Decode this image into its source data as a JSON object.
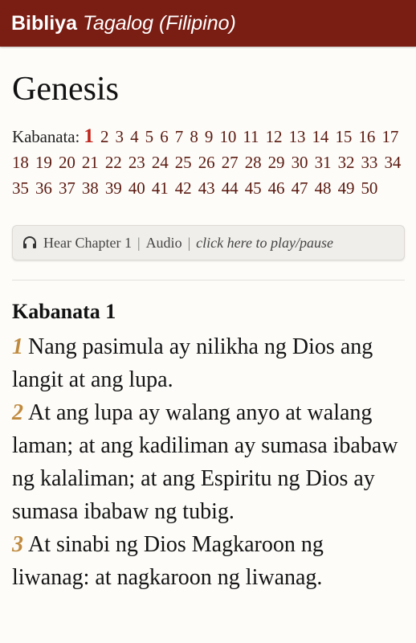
{
  "header": {
    "brand": "Bibliya",
    "language": "Tagalog (Filipino)"
  },
  "book": {
    "title": "Genesis"
  },
  "chapters": {
    "label": "Kabanata:",
    "current": "1",
    "list": [
      "1",
      "2",
      "3",
      "4",
      "5",
      "6",
      "7",
      "8",
      "9",
      "10",
      "11",
      "12",
      "13",
      "14",
      "15",
      "16",
      "17",
      "18",
      "19",
      "20",
      "21",
      "22",
      "23",
      "24",
      "25",
      "26",
      "27",
      "28",
      "29",
      "30",
      "31",
      "32",
      "33",
      "34",
      "35",
      "36",
      "37",
      "38",
      "39",
      "40",
      "41",
      "42",
      "43",
      "44",
      "45",
      "46",
      "47",
      "48",
      "49",
      "50"
    ]
  },
  "audio": {
    "hear_label": "Hear Chapter 1",
    "audio_label": "Audio",
    "separator": "|",
    "play_label": "click here to play/pause",
    "icon": "headphones-icon"
  },
  "chapter_heading": "Kabanata 1",
  "verses": [
    {
      "num": "1",
      "text": "Nang pasimula ay nilikha ng Dios ang langit at ang lupa."
    },
    {
      "num": "2",
      "text": "At ang lupa ay walang anyo at walang laman; at ang kadiliman ay sumasa ibabaw ng kalaliman; at ang Espiritu ng Dios ay sumasa ibabaw ng tubig."
    },
    {
      "num": "3",
      "text": "At sinabi ng Dios Magkaroon ng liwanag: at nagkaroon ng liwanag."
    }
  ],
  "colors": {
    "header_bg": "#7a1d13",
    "chapter_link": "#5b1a10",
    "current_chapter": "#c0241b",
    "verse_number": "#c08a3e"
  }
}
